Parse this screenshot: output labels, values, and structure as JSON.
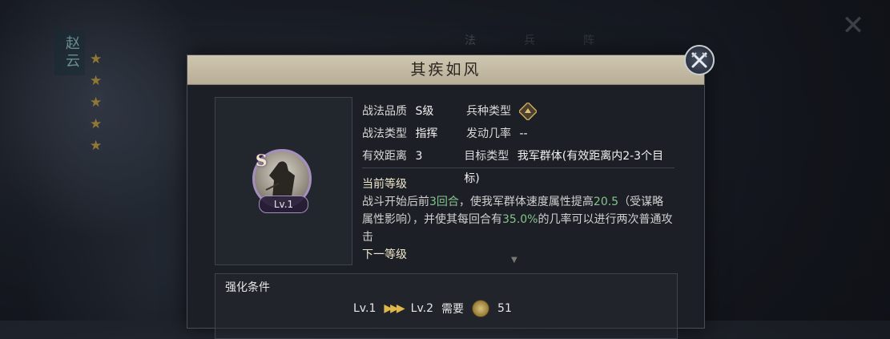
{
  "background": {
    "tabs": [
      "法",
      "兵",
      "阵"
    ],
    "general_name": "赵云",
    "stars": 5
  },
  "dialog": {
    "title": "其疾如风",
    "skill": {
      "grade": "S",
      "level": "Lv.1"
    },
    "info": {
      "quality_label": "战法品质",
      "quality_value": "S级",
      "troop_label": "兵种类型",
      "type_label": "战法类型",
      "type_value": "指挥",
      "rate_label": "发动几率",
      "rate_value": "--",
      "range_label": "有效距离",
      "range_value": "3",
      "target_label": "目标类型",
      "target_value": "我军群体(有效距离内2-3个目标)"
    },
    "current_level_title": "当前等级",
    "desc": {
      "p1": "战斗开始后前",
      "h1": "3回合",
      "p2": "，使我军群体速度属性提高",
      "h2": "20.5",
      "p3": "（受谋略属性影响），并使其每回合有",
      "h3": "35.0%",
      "p4": "的几率可以进行两次普通攻击"
    },
    "next_level_title": "下一等级",
    "enhance": {
      "title": "强化条件",
      "from": "Lv.1",
      "to": "Lv.2",
      "need_label": "需要",
      "cost": "51"
    }
  }
}
